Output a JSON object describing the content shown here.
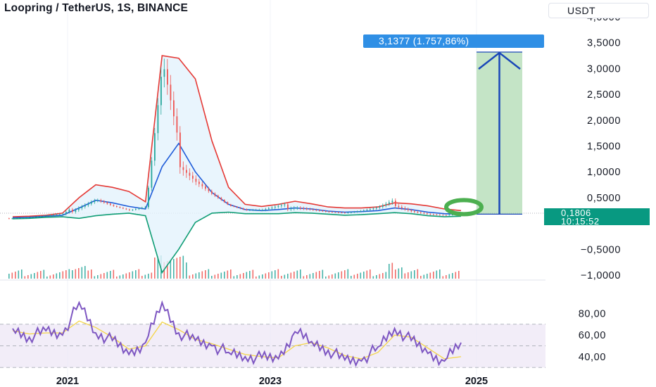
{
  "title": "Loopring / TetherUS, 1S, BINANCE",
  "unit_label": "USDT",
  "last_price": "0,1806",
  "countdown": "10:15:52",
  "target_label": "3,1377 (1.757,86%)",
  "chart_data": [
    {
      "type": "candlestick",
      "title": "Loopring / TetherUS, 1S, BINANCE",
      "x_ticks": [
        "2021",
        "2023",
        "2025"
      ],
      "y_ticks": [
        "4,0000",
        "3,5000",
        "3,0000",
        "2,5000",
        "2,0000",
        "1,5000",
        "1,0000",
        "0,5000",
        "−0,5000",
        "−1,0000"
      ],
      "y_scale": "log",
      "ylim": [
        -1.0,
        4.0
      ],
      "series": [
        {
          "role": "close",
          "x": [
            "2020-05",
            "2020-07",
            "2020-09",
            "2020-11",
            "2021-01",
            "2021-03",
            "2021-05",
            "2021-07",
            "2021-09",
            "2021-11",
            "2022-01",
            "2022-03",
            "2022-05",
            "2022-07",
            "2022-09",
            "2022-11",
            "2023-01",
            "2023-03",
            "2023-05",
            "2023-07",
            "2023-09",
            "2023-11",
            "2024-01",
            "2024-03",
            "2024-05",
            "2024-07",
            "2024-09",
            "2024-11"
          ],
          "values": [
            0.1,
            0.11,
            0.14,
            0.16,
            0.35,
            0.5,
            0.35,
            0.25,
            0.3,
            2.8,
            1.3,
            0.9,
            0.6,
            0.35,
            0.25,
            0.24,
            0.3,
            0.35,
            0.29,
            0.23,
            0.2,
            0.23,
            0.28,
            0.4,
            0.26,
            0.19,
            0.16,
            0.18
          ]
        },
        {
          "role": "bollinger_upper",
          "values": [
            0.13,
            0.14,
            0.16,
            0.2,
            0.5,
            0.75,
            0.7,
            0.62,
            0.42,
            3.25,
            3.2,
            2.8,
            1.6,
            0.7,
            0.37,
            0.33,
            0.37,
            0.43,
            0.38,
            0.32,
            0.3,
            0.3,
            0.32,
            0.4,
            0.38,
            0.34,
            0.28,
            0.25
          ]
        },
        {
          "role": "bollinger_middle",
          "values": [
            0.11,
            0.12,
            0.14,
            0.16,
            0.3,
            0.45,
            0.4,
            0.33,
            0.28,
            1.1,
            1.55,
            1.0,
            0.6,
            0.37,
            0.27,
            0.25,
            0.27,
            0.3,
            0.28,
            0.24,
            0.22,
            0.23,
            0.25,
            0.3,
            0.27,
            0.22,
            0.19,
            0.18
          ]
        },
        {
          "role": "bollinger_lower",
          "values": [
            0.09,
            0.1,
            0.12,
            0.13,
            0.1,
            0.15,
            0.18,
            0.2,
            0.15,
            -0.95,
            -0.5,
            0.02,
            0.2,
            0.22,
            0.19,
            0.19,
            0.19,
            0.21,
            0.2,
            0.18,
            0.16,
            0.17,
            0.19,
            0.21,
            0.19,
            0.15,
            0.13,
            0.14
          ]
        }
      ],
      "annotation": {
        "from": 0.1806,
        "to": 3.3183,
        "change": "3,1377 (1.757,86%)"
      }
    },
    {
      "type": "line",
      "y_ticks": [
        "80,00",
        "60,00",
        "40,00"
      ],
      "levels": [
        70,
        50,
        30
      ],
      "ylim": [
        25,
        90
      ],
      "series": [
        {
          "role": "rsi",
          "x": [
            "2020-05",
            "2020-07",
            "2020-09",
            "2020-11",
            "2021-01",
            "2021-03",
            "2021-05",
            "2021-07",
            "2021-09",
            "2021-11",
            "2022-01",
            "2022-03",
            "2022-05",
            "2022-07",
            "2022-09",
            "2022-11",
            "2023-01",
            "2023-03",
            "2023-05",
            "2023-07",
            "2023-09",
            "2023-11",
            "2024-01",
            "2024-03",
            "2024-05",
            "2024-07",
            "2024-09",
            "2024-11"
          ],
          "values": [
            66,
            58,
            64,
            60,
            90,
            62,
            55,
            42,
            53,
            90,
            62,
            55,
            50,
            44,
            40,
            39,
            38,
            63,
            54,
            46,
            37,
            36,
            49,
            66,
            55,
            43,
            36,
            53
          ]
        },
        {
          "role": "rsi_ma",
          "values": [
            64,
            61,
            62,
            62,
            73,
            67,
            58,
            47,
            50,
            72,
            65,
            56,
            52,
            47,
            42,
            40,
            39,
            50,
            53,
            48,
            41,
            38,
            44,
            60,
            58,
            48,
            38,
            40
          ]
        }
      ]
    }
  ]
}
